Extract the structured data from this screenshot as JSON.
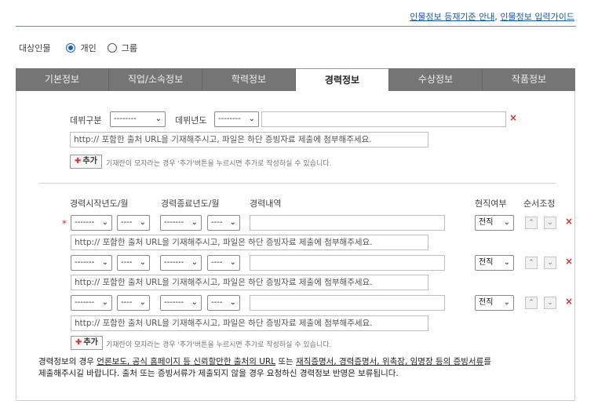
{
  "top_links": {
    "guide1": "인물정보 등재기준 안내",
    "sep": ", ",
    "guide2": "인물정보 입력가이드"
  },
  "target": {
    "label": "대상인물",
    "opt1": "개인",
    "opt2": "그룹"
  },
  "tabs": [
    "기본정보",
    "직업/소속정보",
    "학력정보",
    "경력정보",
    "수상정보",
    "작품정보"
  ],
  "debut": {
    "type_label": "데뷔구분",
    "type_value": "--------",
    "year_label": "데뷔년도",
    "year_value": "--------",
    "url_placeholder": "http:// 포함한 출처 URL을 기재해주시고, 파일은 하단 증빙자료 제출에 첨부해주세요.",
    "add_label": "추가",
    "add_hint": "기재란이 모자라는 경우 '추가'버튼을 누르시면 추가로 작성하실 수 있습니다."
  },
  "career": {
    "col_start": "경력시작년도/월",
    "col_end": "경력종료년도/월",
    "col_detail": "경력내역",
    "col_current": "현직여부",
    "col_order": "순서조정",
    "year_value": "-------",
    "month_value": "----",
    "current_value": "전직",
    "url_placeholder": "http:// 포함한 출처 URL을 기재해주시고, 파일은 하단 증빙자료 제출에 첨부해주세요.",
    "add_label": "추가",
    "add_hint": "기재란이 모자라는 경우 '추가'버튼을 누르시면 추가로 작성하실 수 있습니다."
  },
  "notice": {
    "p1": "경력정보의 경우 ",
    "u1": "언론보도, 공식 홈페이지 등 신뢰할만한 출처의 URL",
    "p2": " 또는 ",
    "u2": "재직증명서, 경력증명서, 위촉장, 임명장 등의 증빙서류",
    "p3": "를",
    "line2": "제출해주시길 바랍니다. 출처 또는 증빙서류가 제출되지 않을 경우 요청하신 경력정보 반영은 보류됩니다."
  },
  "icons": {
    "remove": "close-icon",
    "up": "chevron-up-icon",
    "down": "chevron-down-icon",
    "plus": "plus-icon"
  },
  "colors": {
    "accent": "#1565c0",
    "remove": "#d32f2f",
    "tabbar": "#757575",
    "link": "#1a5aa6"
  }
}
